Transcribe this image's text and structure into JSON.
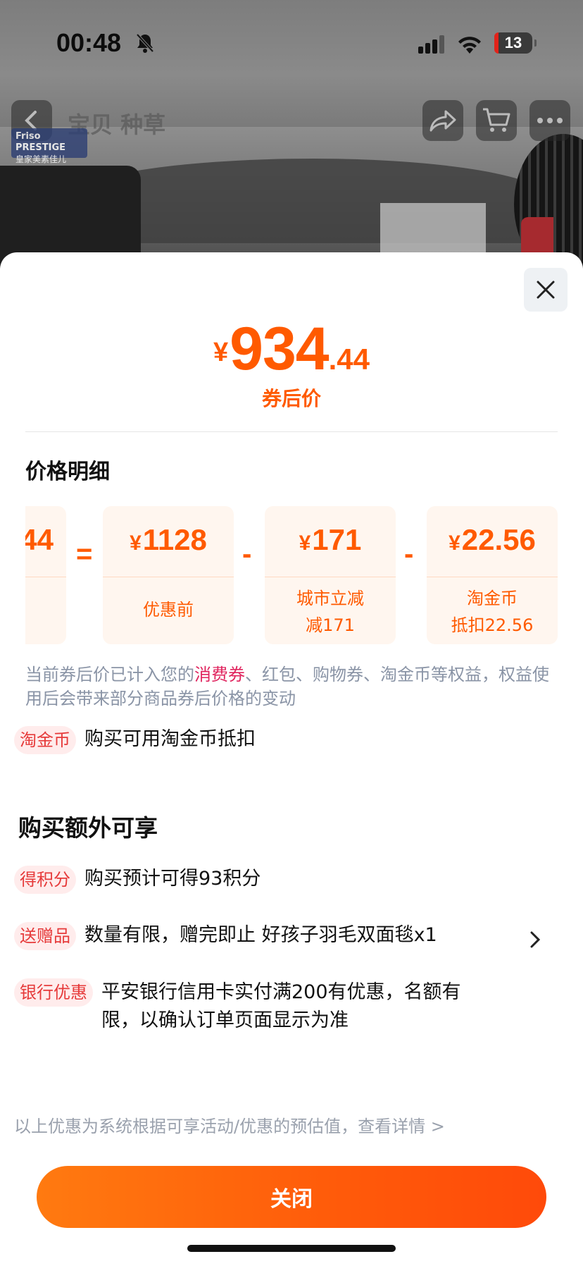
{
  "status_bar": {
    "time": "00:48",
    "battery": "13"
  },
  "background": {
    "nav_title": "宝贝  种草",
    "brand_logo_line1": "Friso PRESTIGE",
    "brand_logo_line2": "皇家美素佳儿"
  },
  "sheet": {
    "price": {
      "currency": "¥",
      "integer": "934",
      "decimal": ".44",
      "label": "券后价"
    },
    "detail_title": "价格明细",
    "breakdown": {
      "partial_card_amount": "44",
      "equals": "=",
      "minus": "-",
      "cards": [
        {
          "currency": "¥",
          "amount": "1128",
          "label": "优惠前"
        },
        {
          "currency": "¥",
          "amount": "171",
          "label": "城市立减\n减171"
        },
        {
          "currency": "¥",
          "amount": "22.56",
          "label": "淘金币\n抵扣22.56"
        }
      ]
    },
    "note": {
      "before": "当前券后价已计入您的",
      "highlight": "消费券",
      "after": "、红包、购物券、淘金币等权益，权益使用后会带来部分商品券后价格的变动"
    },
    "taojinbi": {
      "tag": "淘金币",
      "text": "购买可用淘金币抵扣"
    },
    "extra_title": "购买额外可享",
    "benefits": [
      {
        "tag": "得积分",
        "text": "购买预计可得93积分"
      },
      {
        "tag": "送赠品",
        "text": "数量有限，赠完即止 好孩子羽毛双面毯x1"
      },
      {
        "tag": "银行优惠",
        "text": "平安银行信用卡实付满200有优惠，名额有限，以确认订单页面显示为准"
      }
    ],
    "footnote": "以上优惠为系统根据可享活动/优惠的预估值，查看详情 >",
    "close_button": "关闭"
  },
  "colors": {
    "accent": "#ff5a00",
    "tag_bg": "#ffecec",
    "tag_text": "#e63a3a",
    "highlight": "#e0245e"
  }
}
